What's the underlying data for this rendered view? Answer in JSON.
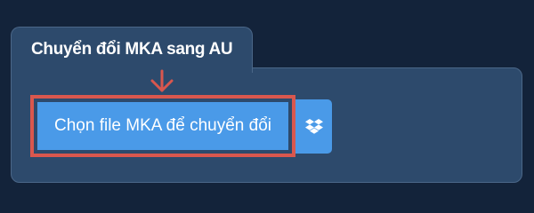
{
  "tab": {
    "title": "Chuyển đổi MKA sang AU"
  },
  "upload": {
    "choose_label": "Chọn file MKA để chuyển đổi",
    "dropbox_icon": "dropbox-icon",
    "arrow_icon": "arrow-down-icon"
  },
  "colors": {
    "background": "#13233a",
    "panel": "#2d4a6c",
    "button": "#4a9ae8",
    "highlight": "#d9574e"
  }
}
